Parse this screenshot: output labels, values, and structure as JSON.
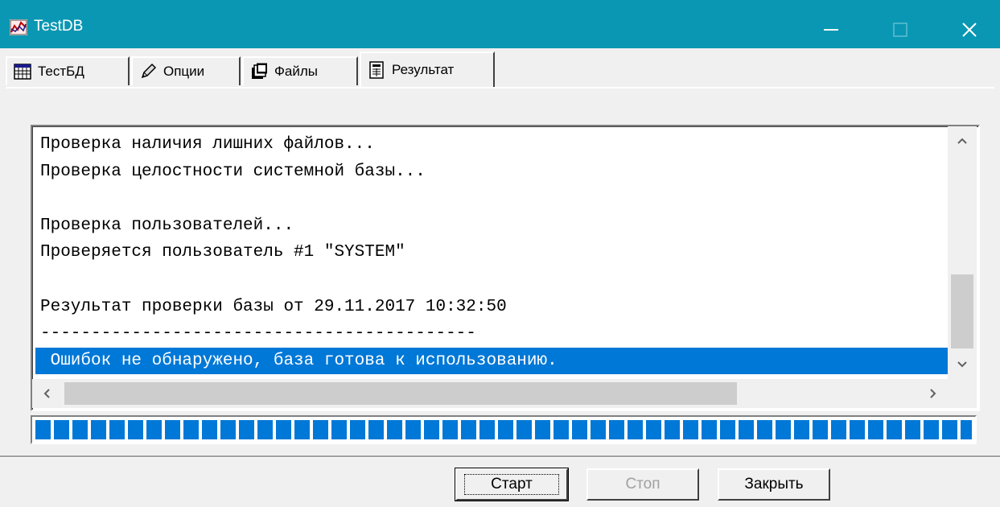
{
  "window": {
    "title": "TestDB",
    "controls": {
      "minimize": "minimize-icon",
      "maximize": "maximize-icon",
      "close": "close-icon"
    }
  },
  "tabs": [
    {
      "label": "ТестБД",
      "icon": "table-icon",
      "active": false
    },
    {
      "label": "Опции",
      "icon": "pencil-icon",
      "active": false
    },
    {
      "label": "Файлы",
      "icon": "files-icon",
      "active": false
    },
    {
      "label": "Результат",
      "icon": "report-icon",
      "active": true
    }
  ],
  "log": {
    "lines": [
      "Проверка наличия лишних файлов...",
      "Проверка целостности системной базы...",
      "",
      "Проверка пользователей...",
      "Проверяется пользователь #1 \"SYSTEM\"",
      "",
      "Результат проверки базы от 29.11.2017 10:32:50",
      "-------------------------------------------",
      " Ошибок не обнаружено, база готова к использованию."
    ],
    "selected_index": 8
  },
  "progress": {
    "value": 1.0,
    "color": "#0078d7"
  },
  "buttons": {
    "start": "Старт",
    "stop": "Стоп",
    "close": "Закрыть"
  },
  "colors": {
    "titlebar": "#0a97b3",
    "selection": "#0078d7"
  }
}
